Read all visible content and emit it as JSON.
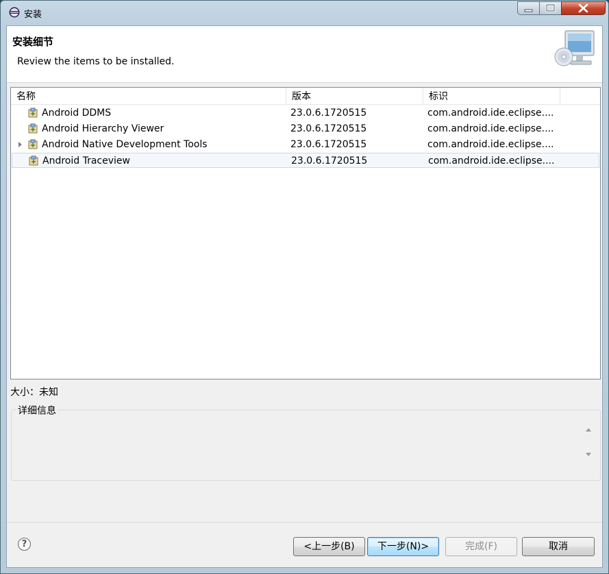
{
  "window": {
    "title": "安装"
  },
  "header": {
    "title": "安装细节",
    "description": "Review the items to be installed."
  },
  "table": {
    "columns": [
      "名称",
      "版本",
      "标识"
    ],
    "rows": [
      {
        "name": "Android DDMS",
        "version": "23.0.6.1720515",
        "id": "com.android.ide.eclipse....",
        "expandable": false
      },
      {
        "name": "Android Hierarchy Viewer",
        "version": "23.0.6.1720515",
        "id": "com.android.ide.eclipse....",
        "expandable": false
      },
      {
        "name": "Android Native Development Tools",
        "version": "23.0.6.1720515",
        "id": "com.android.ide.eclipse....",
        "expandable": true
      },
      {
        "name": "Android Traceview",
        "version": "23.0.6.1720515",
        "id": "com.android.ide.eclipse....",
        "expandable": false,
        "selected": true
      }
    ]
  },
  "size_label": "大小：未知",
  "details": {
    "label": "详细信息",
    "content": ""
  },
  "buttons": {
    "help": "?",
    "back": "<上一步(B)",
    "next": "下一步(N)>",
    "finish": "完成(F)",
    "cancel": "取消"
  },
  "colors": {
    "selection": "#c6d9ec",
    "next_button": "#3c7fb1"
  }
}
